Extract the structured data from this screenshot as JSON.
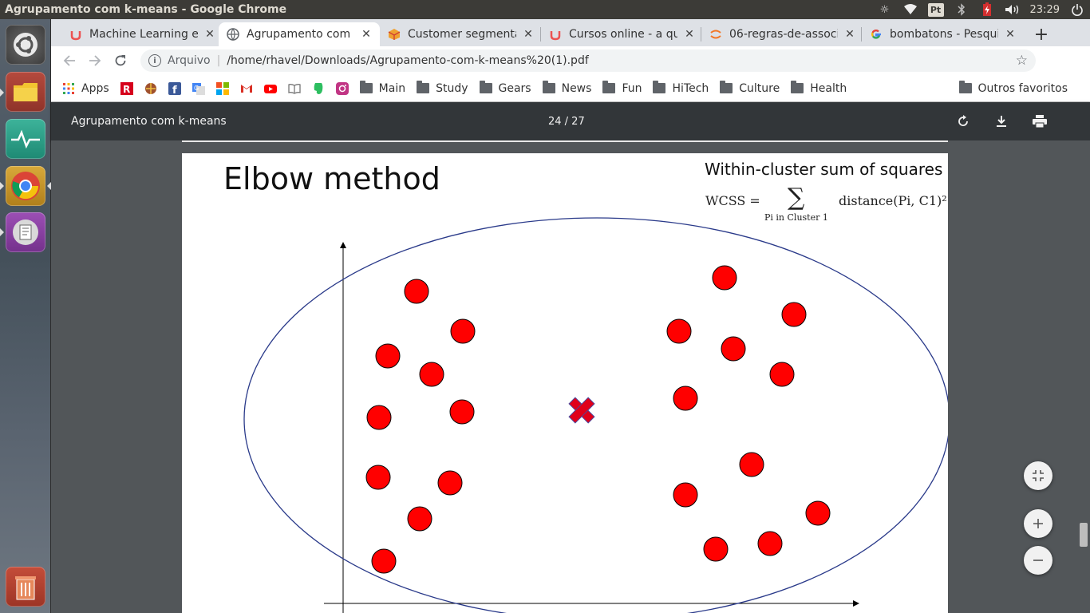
{
  "os": {
    "window_title": "Agrupamento com k-means - Google Chrome",
    "time": "23:29",
    "tray_pt": "Pt"
  },
  "tabs": [
    {
      "label": "Machine Learning e",
      "icon": "udemy-icon"
    },
    {
      "label": "Agrupamento com k",
      "icon": "globe-icon",
      "active": true
    },
    {
      "label": "Customer segmenta",
      "icon": "box-icon"
    },
    {
      "label": "Cursos online - a qu",
      "icon": "udemy-icon"
    },
    {
      "label": "06-regras-de-associa",
      "icon": "jupyter-icon"
    },
    {
      "label": "bombatons - Pesqui",
      "icon": "google-icon"
    }
  ],
  "new_tab_label": "+",
  "toolbar": {
    "scheme": "Arquivo",
    "separator": "|",
    "url": "/home/rhavel/Downloads/Agrupamento-com-k-means%20(1).pdf"
  },
  "bookmarks": {
    "apps_label": "Apps",
    "folders": [
      "Main",
      "Study",
      "Gears",
      "News",
      "Fun",
      "HiTech",
      "Culture",
      "Health"
    ],
    "other_label": "Outros favoritos"
  },
  "pdf": {
    "title": "Agrupamento com k-means",
    "page_indicator": "24 / 27"
  },
  "slide": {
    "title": "Elbow method",
    "wcss_title": "Within-cluster sum of squares",
    "formula_lhs": "WCSS =",
    "formula_sigma": "∑",
    "formula_sub": "Pi in Cluster 1",
    "formula_rhs": "distance(Pi, C1)²"
  },
  "chart_data": {
    "type": "scatter",
    "centroid_color": "#e0001a",
    "point_color": "#ff0000",
    "ellipse_color": "#2a3a8a"
  },
  "colors": {
    "tab_strip": "#dee1e6",
    "pdf_toolbar": "#323639",
    "pdf_background": "#525659",
    "os_panel": "#3c3b37"
  }
}
